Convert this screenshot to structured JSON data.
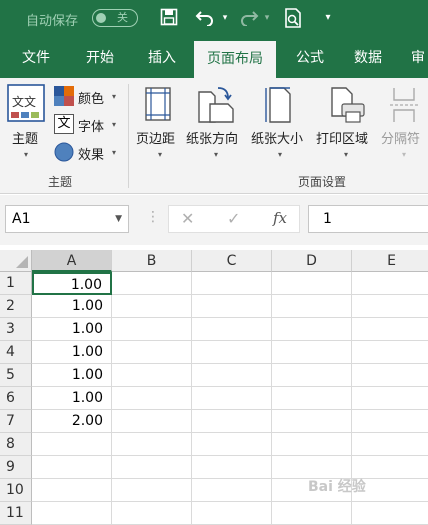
{
  "quick_access": {
    "autosave_label": "自动保存",
    "autosave_state": "关",
    "icons": [
      "save-icon",
      "undo-icon",
      "redo-icon",
      "print-preview-icon",
      "customize-icon"
    ]
  },
  "tabs": [
    {
      "label": "文件"
    },
    {
      "label": "开始"
    },
    {
      "label": "插入"
    },
    {
      "label": "页面布局",
      "active": true
    },
    {
      "label": "公式"
    },
    {
      "label": "数据"
    },
    {
      "label": "审"
    }
  ],
  "ribbon": {
    "theme_group": {
      "themes_label": "主题",
      "colors_label": "颜色",
      "fonts_label": "字体",
      "effects_label": "效果",
      "group_label": "主题"
    },
    "page_setup_group": {
      "margins_label": "页边距",
      "orientation_label": "纸张方向",
      "size_label": "纸张大小",
      "print_area_label": "打印区域",
      "breaks_label": "分隔符",
      "group_label": "页面设置"
    }
  },
  "formula_bar": {
    "name_box": "A1",
    "cancel_icon": "✕",
    "enter_icon": "✓",
    "fx_label": "fx",
    "value": "1"
  },
  "sheet": {
    "columns": [
      "A",
      "B",
      "C",
      "D",
      "E"
    ],
    "rows": [
      {
        "num": "1",
        "a": "1.00"
      },
      {
        "num": "2",
        "a": "1.00"
      },
      {
        "num": "3",
        "a": "1.00"
      },
      {
        "num": "4",
        "a": "1.00"
      },
      {
        "num": "5",
        "a": "1.00"
      },
      {
        "num": "6",
        "a": "1.00"
      },
      {
        "num": "7",
        "a": "2.00"
      },
      {
        "num": "8",
        "a": ""
      },
      {
        "num": "9",
        "a": ""
      },
      {
        "num": "10",
        "a": ""
      },
      {
        "num": "11",
        "a": ""
      }
    ]
  },
  "watermark": "Bai 经验",
  "colors": {
    "accent": "#217346",
    "ribbon_bg": "#f3f3f3"
  }
}
